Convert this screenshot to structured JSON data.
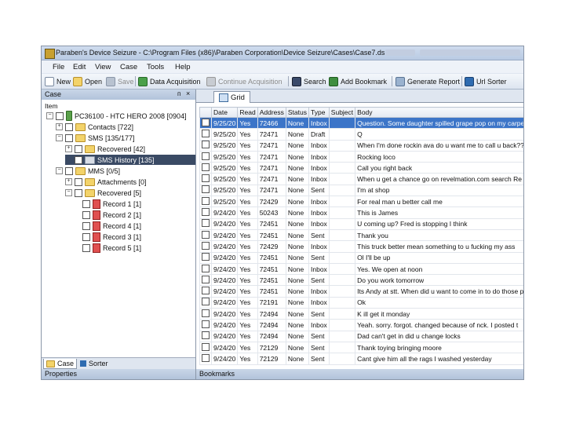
{
  "window": {
    "title": "Paraben's Device Seizure - C:\\Program Files (x86)\\Paraben Corporation\\Device Seizure\\Cases\\Case7.ds"
  },
  "menu": [
    "File",
    "Edit",
    "View",
    "Case",
    "Tools",
    "Help"
  ],
  "toolbar": [
    {
      "label": "New",
      "icon": "new-icon",
      "enabled": true
    },
    {
      "label": "Open",
      "icon": "open-folder-icon",
      "enabled": true
    },
    {
      "label": "Save",
      "icon": "save-icon",
      "enabled": false
    },
    {
      "label": "Data Acquisition",
      "icon": "acquisition-icon",
      "enabled": true
    },
    {
      "label": "Continue Acquisition",
      "icon": "continue-icon",
      "enabled": false
    },
    {
      "label": "Search",
      "icon": "binoculars-icon",
      "enabled": true
    },
    {
      "label": "Add Bookmark",
      "icon": "bookmark-icon",
      "enabled": true
    },
    {
      "label": "Generate Report",
      "icon": "report-icon",
      "enabled": true
    },
    {
      "label": "Url Sorter",
      "icon": "sorter-icon",
      "enabled": true
    }
  ],
  "case_panel": {
    "title": "Case",
    "pin": "ᴨ",
    "close": "×",
    "header": "Item",
    "tree": [
      {
        "label": "PC36100 - HTC HERO 2008 [0904]",
        "icon": "phone-icon",
        "expander": "−"
      },
      {
        "label": "Contacts [722]",
        "icon": "folder-icon",
        "expander": "+"
      },
      {
        "label": "SMS [135/177]",
        "icon": "folder-icon",
        "expander": "−"
      },
      {
        "label": "Recovered [42]",
        "icon": "folder-icon",
        "expander": "+"
      },
      {
        "label": "SMS History [135]",
        "icon": "folder-icon",
        "expander": "",
        "selected": true
      },
      {
        "label": "MMS [0/5]",
        "icon": "folder-icon",
        "expander": "−"
      },
      {
        "label": "Attachments [0]",
        "icon": "folder-icon",
        "expander": "+"
      },
      {
        "label": "Recovered [5]",
        "icon": "folder-icon",
        "expander": "−"
      },
      {
        "label": "Record 1 [1]",
        "icon": "record-icon",
        "expander": ""
      },
      {
        "label": "Record 2 [1]",
        "icon": "record-icon",
        "expander": ""
      },
      {
        "label": "Record 4 [1]",
        "icon": "record-icon",
        "expander": ""
      },
      {
        "label": "Record 3 [1]",
        "icon": "record-icon",
        "expander": ""
      },
      {
        "label": "Record 5 [1]",
        "icon": "record-icon",
        "expander": ""
      }
    ],
    "tabs": [
      "Case",
      "Sorter"
    ],
    "bottom_title": "Properties"
  },
  "grid": {
    "tab_label": "Grid",
    "columns": [
      "Date",
      "Read",
      "Address",
      "Status",
      "Type",
      "Subject",
      "Body"
    ],
    "rows": [
      [
        "9/25/20",
        "Yes",
        "72466",
        "None",
        "Inbox",
        "",
        "Question. Some daughter spilled grape pop on my carpet"
      ],
      [
        "9/25/20",
        "Yes",
        "72471",
        "None",
        "Draft",
        "",
        "Q"
      ],
      [
        "9/25/20",
        "Yes",
        "72471",
        "None",
        "Inbox",
        "",
        "When I'm done rockin ava do u want me to call u back??"
      ],
      [
        "9/25/20",
        "Yes",
        "72471",
        "None",
        "Inbox",
        "",
        "Rocking loco"
      ],
      [
        "9/25/20",
        "Yes",
        "72471",
        "None",
        "Inbox",
        "",
        "Call you right back"
      ],
      [
        "9/25/20",
        "Yes",
        "72471",
        "None",
        "Inbox",
        "",
        "When u get a chance go on revelmation.com search Re"
      ],
      [
        "9/25/20",
        "Yes",
        "72471",
        "None",
        "Sent",
        "",
        "I'm at shop"
      ],
      [
        "9/25/20",
        "Yes",
        "72429",
        "None",
        "Inbox",
        "",
        "For real man u better call me"
      ],
      [
        "9/24/20",
        "Yes",
        "50243",
        "None",
        "Inbox",
        "",
        "This is James"
      ],
      [
        "9/24/20",
        "Yes",
        "72451",
        "None",
        "Inbox",
        "",
        "U coming up? Fred is stopping I think"
      ],
      [
        "9/24/20",
        "Yes",
        "72451",
        "None",
        "Sent",
        "",
        "Thank you"
      ],
      [
        "9/24/20",
        "Yes",
        "72429",
        "None",
        "Inbox",
        "",
        "This truck better mean something to u fucking my ass"
      ],
      [
        "9/24/20",
        "Yes",
        "72451",
        "None",
        "Sent",
        "",
        "Ol I'll be up"
      ],
      [
        "9/24/20",
        "Yes",
        "72451",
        "None",
        "Inbox",
        "",
        "Yes. We open at noon"
      ],
      [
        "9/24/20",
        "Yes",
        "72451",
        "None",
        "Sent",
        "",
        "Do you work tomorrow"
      ],
      [
        "9/24/20",
        "Yes",
        "72451",
        "None",
        "Inbox",
        "",
        "Its Andy at stt. When did u want to come in to do those p"
      ],
      [
        "9/24/20",
        "Yes",
        "72191",
        "None",
        "Inbox",
        "",
        "Ok"
      ],
      [
        "9/24/20",
        "Yes",
        "72494",
        "None",
        "Sent",
        "",
        "K ill get it monday"
      ],
      [
        "9/24/20",
        "Yes",
        "72494",
        "None",
        "Inbox",
        "",
        "Yeah. sorry. forgot. changed because of nck. I posted t"
      ],
      [
        "9/24/20",
        "Yes",
        "72494",
        "None",
        "Sent",
        "",
        "Dad can't get in did u change locks"
      ],
      [
        "9/24/20",
        "Yes",
        "72129",
        "None",
        "Sent",
        "",
        "Thank toying bringing moore"
      ],
      [
        "9/24/20",
        "Yes",
        "72129",
        "None",
        "Sent",
        "",
        "Cant give him all the rags I washed yesterday"
      ]
    ],
    "selected_row": 0,
    "bottom_title": "Bookmarks"
  }
}
